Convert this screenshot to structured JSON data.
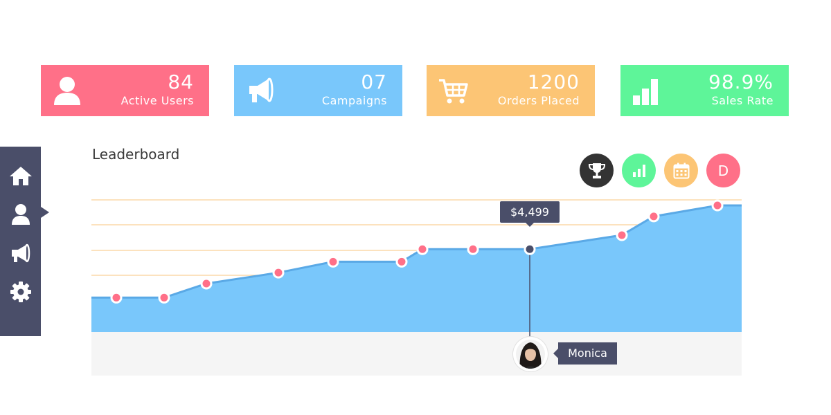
{
  "stats": [
    {
      "value": "84",
      "label": "Active Users",
      "icon": "user-icon",
      "color": "#ff7088"
    },
    {
      "value": "07",
      "label": "Campaigns",
      "icon": "megaphone-icon",
      "color": "#79c7fb"
    },
    {
      "value": "1200",
      "label": "Orders Placed",
      "icon": "cart-icon",
      "color": "#fcc575"
    },
    {
      "value": "98.9%",
      "label": "Sales Rate",
      "icon": "bar-chart-icon",
      "color": "#5ef599"
    }
  ],
  "sidebar": {
    "items": [
      {
        "icon": "home-icon"
      },
      {
        "icon": "user-icon",
        "active": true
      },
      {
        "icon": "megaphone-icon"
      },
      {
        "icon": "gear-icon"
      }
    ],
    "color": "#4a4e69"
  },
  "leaderboard": {
    "title": "Leaderboard",
    "filters": [
      {
        "icon": "trophy-icon",
        "color": "#333333"
      },
      {
        "icon": "bar-chart-icon",
        "color": "#5ef599"
      },
      {
        "icon": "calendar-icon",
        "color": "#fcc575"
      },
      {
        "label": "D",
        "color": "#ff7088"
      }
    ],
    "tooltip_value": "$4,499",
    "selected_user": "Monica"
  },
  "chart_data": {
    "type": "area",
    "values": [
      0.22,
      0.22,
      0.31,
      0.38,
      0.45,
      0.45,
      0.53,
      0.53,
      0.53,
      0.62,
      0.74,
      0.81
    ],
    "selected_index": 8,
    "area_color": "#79c7fb",
    "line_color": "#5aa9e6",
    "point_color": "#ff7088"
  }
}
